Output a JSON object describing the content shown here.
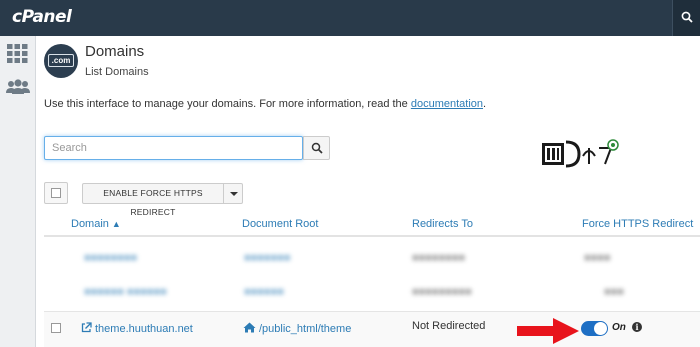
{
  "app": {
    "logo_text": "cPanel"
  },
  "sidebar": {
    "items": [
      {
        "icon": "grid-icon"
      },
      {
        "icon": "users-icon"
      }
    ]
  },
  "header": {
    "badge_text": ".com",
    "title": "Domains",
    "subtitle": "List Domains"
  },
  "intro": {
    "text": "Use this interface to manage your domains. For more information, read the ",
    "link_label": "documentation",
    "suffix": "."
  },
  "search": {
    "value": "",
    "placeholder": "Search"
  },
  "bulk": {
    "https_button_label": "ENABLE FORCE HTTPS REDIRECT"
  },
  "table": {
    "columns": [
      "Domain",
      "Document Root",
      "Redirects To",
      "Force HTTPS Redirect"
    ],
    "sort_column": "Domain",
    "rows": [
      {
        "domain": "theme.huuthuan.net",
        "document_root": "/public_html/theme",
        "redirects_to": "Not Redirected",
        "force_https": "On"
      }
    ]
  },
  "colors": {
    "topbar": "#293a4a",
    "link": "#2d7cb5",
    "toggle_on": "#1e6fc4",
    "arrow": "#e8141c"
  }
}
